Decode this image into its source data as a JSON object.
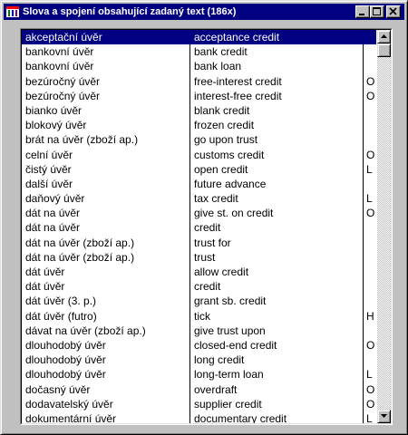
{
  "window": {
    "title": "Slova a spojení obsahující zadaný text (186x)"
  },
  "title_buttons": {
    "minimize_icon": "minimize-icon",
    "maximize_icon": "maximize-icon",
    "close_icon": "close-icon"
  },
  "colors": {
    "titlebar": "#000080",
    "selection": "#000080",
    "face": "#c0c0c0"
  },
  "rows": [
    {
      "cz": "akceptační úvěr",
      "en": "acceptance credit",
      "flag": "",
      "selected": true
    },
    {
      "cz": "bankovní úvěr",
      "en": "bank credit",
      "flag": ""
    },
    {
      "cz": "bankovní úvěr",
      "en": "bank loan",
      "flag": ""
    },
    {
      "cz": "bezúročný úvěr",
      "en": "free-interest credit",
      "flag": "O"
    },
    {
      "cz": "bezúročný úvěr",
      "en": "interest-free credit",
      "flag": "O"
    },
    {
      "cz": "bianko úvěr",
      "en": "blank credit",
      "flag": ""
    },
    {
      "cz": "blokový úvěr",
      "en": "frozen credit",
      "flag": ""
    },
    {
      "cz": "brát na úvěr (zboží ap.)",
      "en": "go upon trust",
      "flag": ""
    },
    {
      "cz": "celní úvěr",
      "en": "customs credit",
      "flag": "O"
    },
    {
      "cz": "čistý úvěr",
      "en": "open credit",
      "flag": "L"
    },
    {
      "cz": "další úvěr",
      "en": "future advance",
      "flag": ""
    },
    {
      "cz": "daňový úvěr",
      "en": "tax credit",
      "flag": "L"
    },
    {
      "cz": "dát na úvěr",
      "en": "give st. on credit",
      "flag": "O"
    },
    {
      "cz": "dát na úvěr",
      "en": "credit",
      "flag": ""
    },
    {
      "cz": "dát na úvěr (zboží ap.)",
      "en": "trust for",
      "flag": ""
    },
    {
      "cz": "dát na úvěr (zboží ap.)",
      "en": "trust",
      "flag": ""
    },
    {
      "cz": "dát úvěr",
      "en": "allow credit",
      "flag": ""
    },
    {
      "cz": "dát úvěr",
      "en": "credit",
      "flag": ""
    },
    {
      "cz": "dát úvěr (3. p.)",
      "en": "grant sb. credit",
      "flag": ""
    },
    {
      "cz": "dát úvěr (futro)",
      "en": "tick",
      "flag": "H"
    },
    {
      "cz": "dávat na úvěr (zboží ap.)",
      "en": "give trust upon",
      "flag": ""
    },
    {
      "cz": "dlouhodobý úvěr",
      "en": "closed-end credit",
      "flag": "O"
    },
    {
      "cz": "dlouhodobý úvěr",
      "en": "long credit",
      "flag": ""
    },
    {
      "cz": "dlouhodobý úvěr",
      "en": "long-term loan",
      "flag": "L"
    },
    {
      "cz": "dočasný úvěr",
      "en": "overdraft",
      "flag": "O"
    },
    {
      "cz": "dodavatelský úvěr",
      "en": "supplier credit",
      "flag": "O"
    },
    {
      "cz": "dokumentární úvěr",
      "en": "documentary credit",
      "flag": "L"
    }
  ],
  "scrollbar": {
    "position_fraction": 0.0
  }
}
